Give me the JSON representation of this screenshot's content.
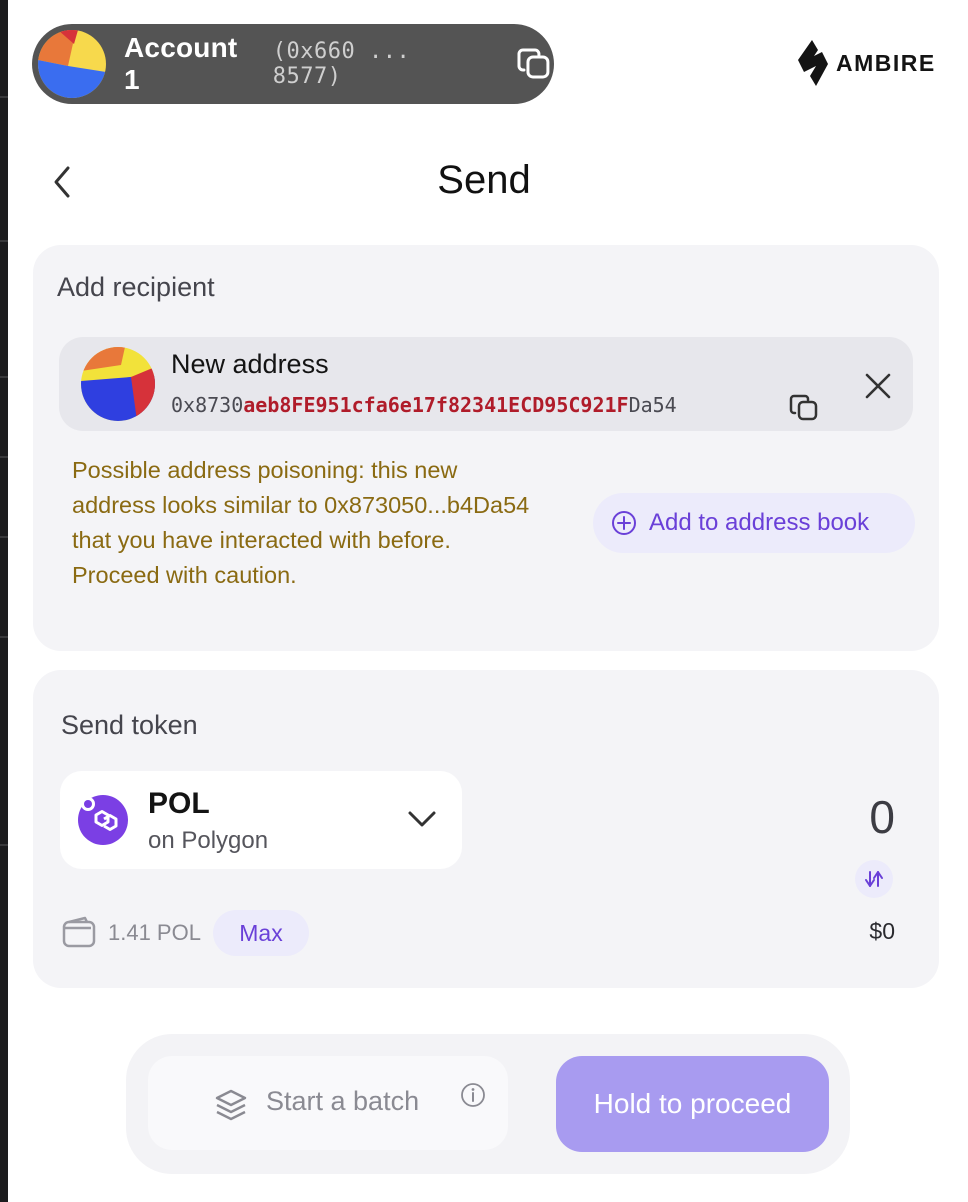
{
  "account": {
    "name": "Account 1",
    "address_short": "(0x660 ... 8577)"
  },
  "brand": {
    "name": "AMBIRE"
  },
  "page": {
    "title": "Send"
  },
  "recipient": {
    "section_label": "Add recipient",
    "title": "New address",
    "address_prefix": "0x8730",
    "address_highlight": "aeb8FE951cfa6e17f82341ECD95C921F",
    "address_suffix": "Da54",
    "warning": "Possible address poisoning: this new address looks similar to 0x873050...b4Da54 that you have interacted with before. Proceed with caution.",
    "add_book_label": "Add to address book"
  },
  "token": {
    "section_label": "Send token",
    "symbol": "POL",
    "network": "on Polygon",
    "amount": "0",
    "usd": "$0",
    "balance": "1.41 POL",
    "max_label": "Max"
  },
  "footer": {
    "batch_label": "Start a batch",
    "proceed_label": "Hold to proceed"
  },
  "colors": {
    "accent": "#6a40d8",
    "warning": "#8a6a12",
    "address_highlight": "#b01c2a",
    "proceed_button": "#a89bf0",
    "account_pill": "#545454"
  },
  "icons": [
    "copy-icon",
    "ambire-logo-icon",
    "chevron-left-icon",
    "close-icon",
    "plus-circle-icon",
    "polygon-icon",
    "chevron-down-icon",
    "swap-icon",
    "wallet-icon",
    "layers-icon",
    "info-icon"
  ]
}
